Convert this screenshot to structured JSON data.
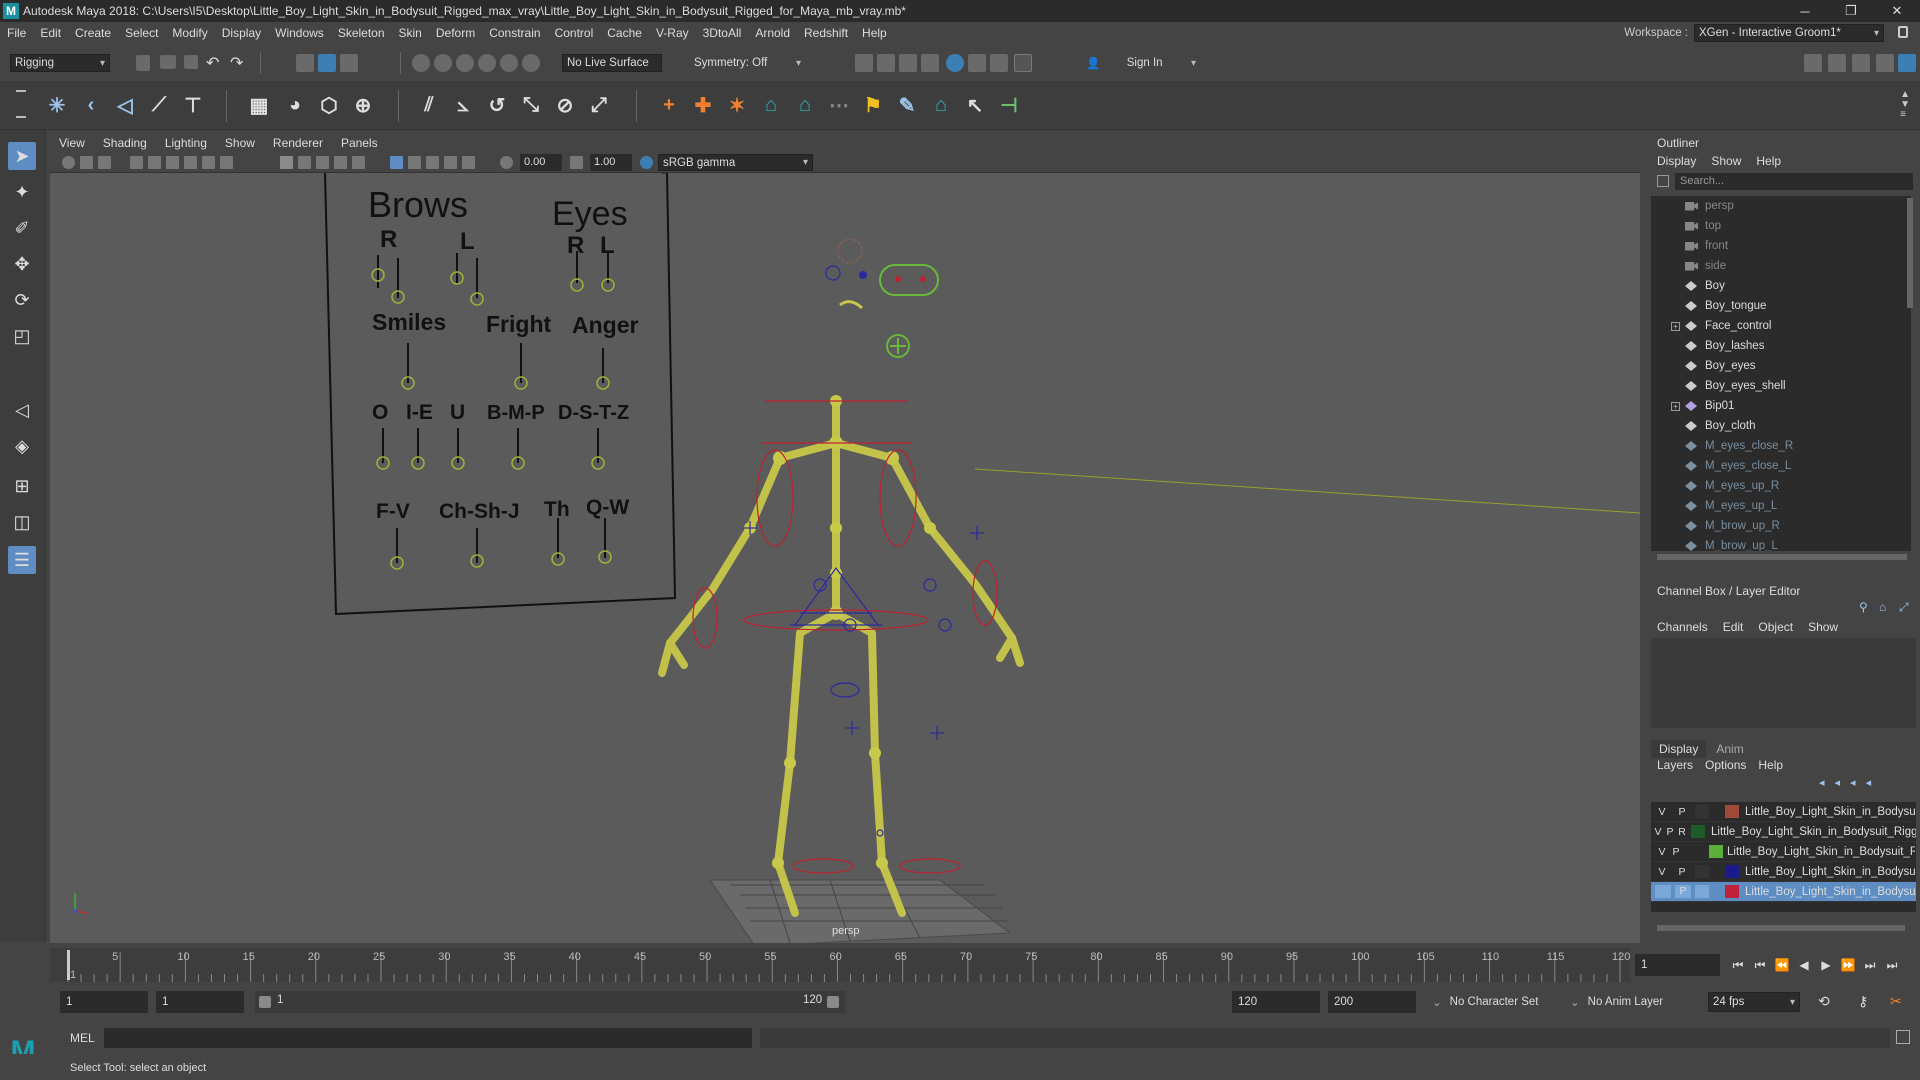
{
  "window": {
    "title": "Autodesk Maya 2018: C:\\Users\\I5\\Desktop\\Little_Boy_Light_Skin_in_Bodysuit_Rigged_max_vray\\Little_Boy_Light_Skin_in_Bodysuit_Rigged_for_Maya_mb_vray.mb*",
    "logo_letter": "M"
  },
  "menubar": {
    "items": [
      "File",
      "Edit",
      "Create",
      "Select",
      "Modify",
      "Display",
      "Windows",
      "Skeleton",
      "Skin",
      "Deform",
      "Constrain",
      "Control",
      "Cache",
      "V-Ray",
      "3DtoAll",
      "Arnold",
      "Redshift",
      "Help"
    ],
    "workspace_label": "Workspace :",
    "workspace_value": "XGen - Interactive Groom1*"
  },
  "statusline": {
    "mode": "Rigging",
    "live_surface": "No Live Surface",
    "symmetry": "Symmetry: Off",
    "sign_in": "Sign In"
  },
  "panel": {
    "menu": [
      "View",
      "Shading",
      "Lighting",
      "Show",
      "Renderer",
      "Panels"
    ],
    "exposure": "0.00",
    "gamma": "1.00",
    "colorspace": "sRGB gamma",
    "camera_label": "persp"
  },
  "face_board": {
    "brows": "Brows",
    "eyes": "Eyes",
    "r1": "R",
    "l1": "L",
    "r2": "R",
    "l2": "L",
    "smiles": "Smiles",
    "fright": "Fright",
    "anger": "Anger",
    "o": "O",
    "ie": "I-E",
    "u": "U",
    "bmp": "B-M-P",
    "dstz": "D-S-T-Z",
    "fv": "F-V",
    "chshj": "Ch-Sh-J",
    "th": "Th",
    "qw": "Q-W"
  },
  "outliner": {
    "title": "Outliner",
    "menu": [
      "Display",
      "Show",
      "Help"
    ],
    "search_placeholder": "Search...",
    "items": [
      {
        "label": "persp",
        "type": "camera",
        "dim": true
      },
      {
        "label": "top",
        "type": "camera",
        "dim": true
      },
      {
        "label": "front",
        "type": "camera",
        "dim": true
      },
      {
        "label": "side",
        "type": "camera",
        "dim": true
      },
      {
        "label": "Boy",
        "type": "mesh"
      },
      {
        "label": "Boy_tongue",
        "type": "mesh"
      },
      {
        "label": "Face_control",
        "type": "mesh",
        "expandable": true
      },
      {
        "label": "Boy_lashes",
        "type": "mesh"
      },
      {
        "label": "Boy_eyes",
        "type": "mesh"
      },
      {
        "label": "Boy_eyes_shell",
        "type": "mesh"
      },
      {
        "label": "Bip01",
        "type": "joint",
        "expandable": true
      },
      {
        "label": "Boy_cloth",
        "type": "mesh"
      },
      {
        "label": "M_eyes_close_R",
        "type": "mesh",
        "faded": true
      },
      {
        "label": "M_eyes_close_L",
        "type": "mesh",
        "faded": true
      },
      {
        "label": "M_eyes_up_R",
        "type": "mesh",
        "faded": true
      },
      {
        "label": "M_eyes_up_L",
        "type": "mesh",
        "faded": true
      },
      {
        "label": "M_brow_up_R",
        "type": "mesh",
        "faded": true
      },
      {
        "label": "M_brow_up_L",
        "type": "mesh",
        "faded": true
      }
    ]
  },
  "channelbox": {
    "title": "Channel Box / Layer Editor",
    "menu": [
      "Channels",
      "Edit",
      "Object",
      "Show"
    ]
  },
  "layereditor": {
    "tabs": [
      "Display",
      "Anim"
    ],
    "menu": [
      "Layers",
      "Options",
      "Help"
    ],
    "layers": [
      {
        "v": "V",
        "p": "P",
        "r": "",
        "color": "#a04a3a",
        "name": "Little_Boy_Light_Skin_in_Bodysuit"
      },
      {
        "v": "V",
        "p": "P",
        "r": "R",
        "color": "#1f5a2a",
        "name": "Little_Boy_Light_Skin_in_Bodysuit_Rigg"
      },
      {
        "v": "V",
        "p": "P",
        "r": "",
        "color": "#5ab03a",
        "name": "Little_Boy_Light_Skin_in_Bodysuit_Ri"
      },
      {
        "v": "V",
        "p": "P",
        "r": "",
        "color": "#1a1a8a",
        "name": "Little_Boy_Light_Skin_in_Bodysuit"
      },
      {
        "v": "",
        "p": "P",
        "r": "",
        "color": "#c0203a",
        "name": "Little_Boy_Light_Skin_in_Bodysui",
        "selected": true
      }
    ]
  },
  "timeline": {
    "ticks": [
      "1",
      "5",
      "10",
      "15",
      "20",
      "25",
      "30",
      "35",
      "40",
      "45",
      "50",
      "55",
      "60",
      "65",
      "70",
      "75",
      "80",
      "85",
      "90",
      "95",
      "100",
      "105",
      "110",
      "115",
      "120"
    ],
    "current_frame": "1"
  },
  "range": {
    "start": "1",
    "playback_start": "1",
    "slider_start": "1",
    "slider_end": "120",
    "playback_end": "120",
    "end": "200",
    "character_set": "No Character Set",
    "anim_layer": "No Anim Layer",
    "fps": "24 fps"
  },
  "cmdline": {
    "label": "MEL"
  },
  "helpline": {
    "text": "Select Tool: select an object"
  }
}
